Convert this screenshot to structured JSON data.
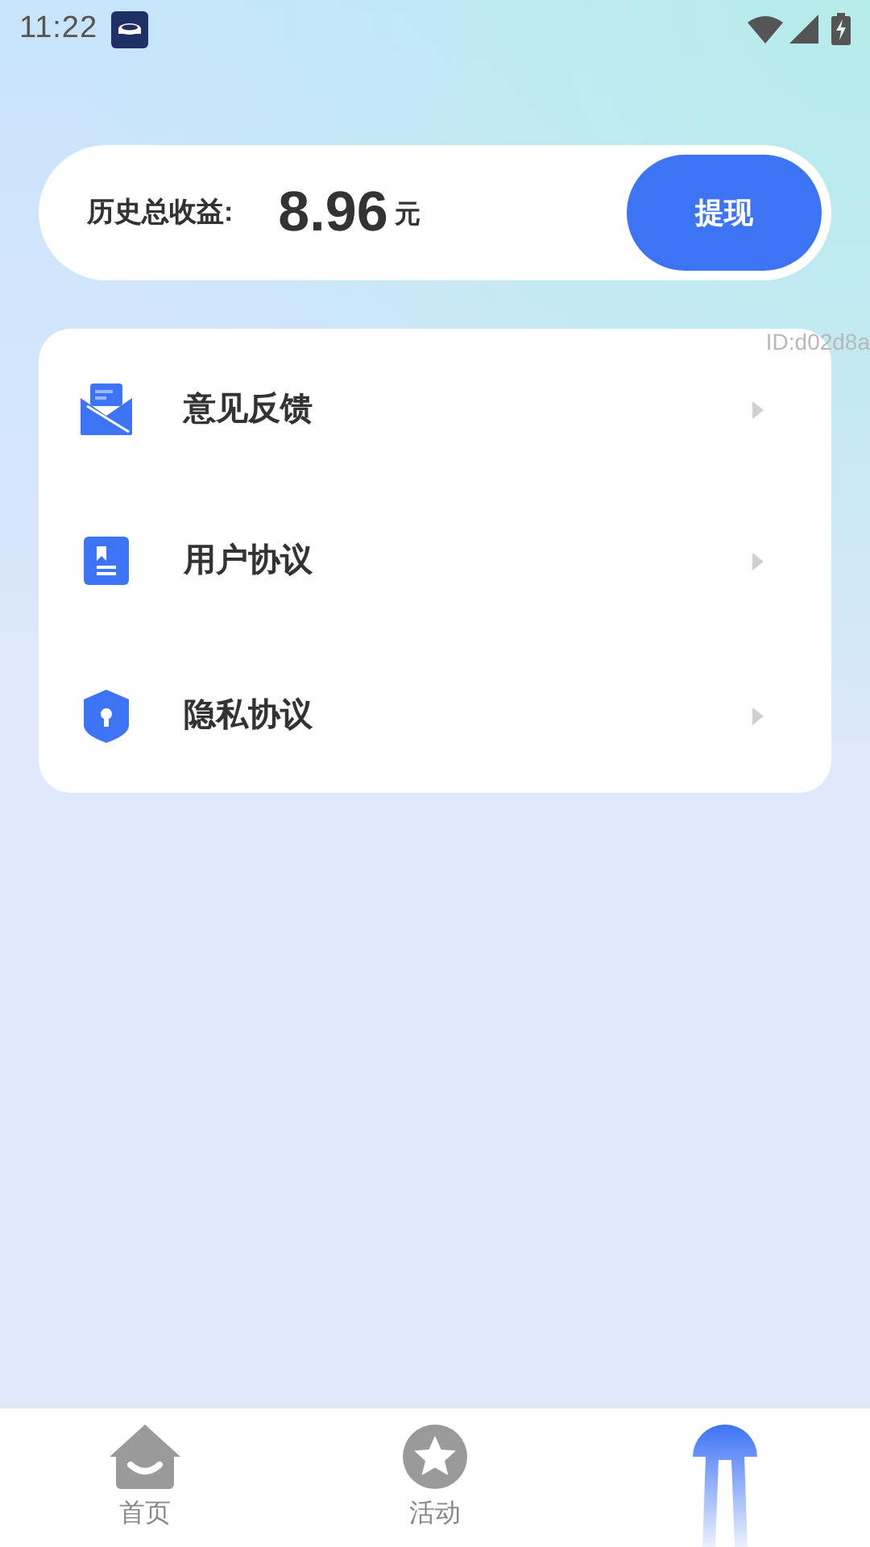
{
  "status_bar": {
    "time": "11:22"
  },
  "earnings": {
    "label": "历史总收益:",
    "amount": "8.96",
    "unit": "元",
    "button": "提现"
  },
  "id_label": "ID:d02d8a",
  "menu": [
    {
      "kind": "feedback",
      "label": "意见反馈"
    },
    {
      "kind": "agreement",
      "label": "用户协议"
    },
    {
      "kind": "privacy",
      "label": "隐私协议"
    }
  ],
  "tabs": [
    {
      "kind": "home",
      "label": "首页",
      "selected": false
    },
    {
      "kind": "activity",
      "label": "活动",
      "selected": false
    },
    {
      "kind": "mine",
      "selected": true
    }
  ]
}
